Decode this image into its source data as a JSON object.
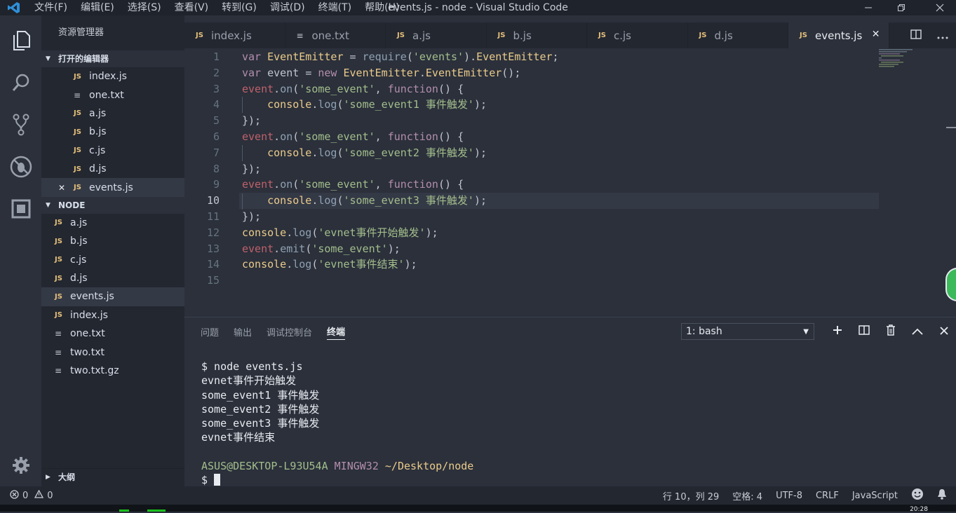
{
  "titlebar": {
    "menus": [
      "文件(F)",
      "编辑(E)",
      "选择(S)",
      "查看(V)",
      "转到(G)",
      "调试(D)",
      "终端(T)",
      "帮助(H)"
    ],
    "window_title": "events.js - node - Visual Studio Code"
  },
  "activity_icons": [
    "explorer-icon",
    "search-icon",
    "source-control-icon",
    "debug-icon",
    "extensions-icon",
    "gear-icon"
  ],
  "sidebar": {
    "title": "资源管理器",
    "open_editors_label": "打开的编辑器",
    "open_editors": [
      {
        "name": "index.js",
        "type": "JS"
      },
      {
        "name": "one.txt",
        "type": "≡"
      },
      {
        "name": "a.js",
        "type": "JS"
      },
      {
        "name": "b.js",
        "type": "JS"
      },
      {
        "name": "c.js",
        "type": "JS"
      },
      {
        "name": "d.js",
        "type": "JS"
      },
      {
        "name": "events.js",
        "type": "JS",
        "close": "✕"
      }
    ],
    "folder_label": "NODE",
    "files": [
      {
        "name": "a.js",
        "type": "JS"
      },
      {
        "name": "b.js",
        "type": "JS"
      },
      {
        "name": "c.js",
        "type": "JS"
      },
      {
        "name": "d.js",
        "type": "JS"
      },
      {
        "name": "events.js",
        "type": "JS"
      },
      {
        "name": "index.js",
        "type": "JS"
      },
      {
        "name": "one.txt",
        "type": "≡"
      },
      {
        "name": "two.txt",
        "type": "≡"
      },
      {
        "name": "two.txt.gz",
        "type": "≡"
      }
    ],
    "outline_label": "大纲"
  },
  "tabs": [
    {
      "name": "index.js",
      "type": "JS"
    },
    {
      "name": "one.txt",
      "type": "≡"
    },
    {
      "name": "a.js",
      "type": "JS"
    },
    {
      "name": "b.js",
      "type": "JS"
    },
    {
      "name": "c.js",
      "type": "JS"
    },
    {
      "name": "d.js",
      "type": "JS"
    },
    {
      "name": "events.js",
      "type": "JS",
      "close": "✕"
    }
  ],
  "editor": {
    "line_numbers": [
      "1",
      "2",
      "3",
      "4",
      "5",
      "6",
      "7",
      "8",
      "9",
      "10",
      "11",
      "12",
      "13",
      "14",
      "15"
    ],
    "lines": [
      "var EventEmitter = require('events').EventEmitter;",
      "var event = new EventEmitter.EventEmitter();",
      "event.on('some_event', function() {",
      "    console.log('some_event1 事件触发');",
      "});",
      "event.on('some_event', function() {",
      "    console.log('some_event2 事件触发');",
      "});",
      "event.on('some_event', function() {",
      "    console.log('some_event3 事件触发');",
      "});",
      "console.log('evnet事件开始触发');",
      "event.emit('some_event');",
      "console.log('evnet事件结束');",
      ""
    ]
  },
  "panel": {
    "tabs": [
      "问题",
      "输出",
      "调试控制台",
      "终端"
    ],
    "terminal_select": "1: bash",
    "terminal_lines": [
      "$ node events.js",
      "evnet事件开始触发",
      "some_event1 事件触发",
      "some_event2 事件触发",
      "some_event3 事件触发",
      "evnet事件结束",
      ""
    ],
    "prompt_user": "ASUS@DESKTOP-L93U54A",
    "prompt_env": "MINGW32",
    "prompt_path": "~/Desktop/node",
    "prompt_symbol": "$"
  },
  "statusbar": {
    "errors": "0",
    "warnings": "0",
    "position": "行 10，列 29",
    "spaces": "空格: 4",
    "encoding": "UTF-8",
    "eol": "CRLF",
    "language": "JavaScript"
  },
  "taskbar": {
    "clock": "20:28"
  },
  "colors": {
    "keyword": "#b48ead",
    "function": "#8fa1b3",
    "string": "#a3be8c",
    "class": "#ebcb8b",
    "variable": "#bf616a",
    "js_badge": "#e5c07b"
  }
}
